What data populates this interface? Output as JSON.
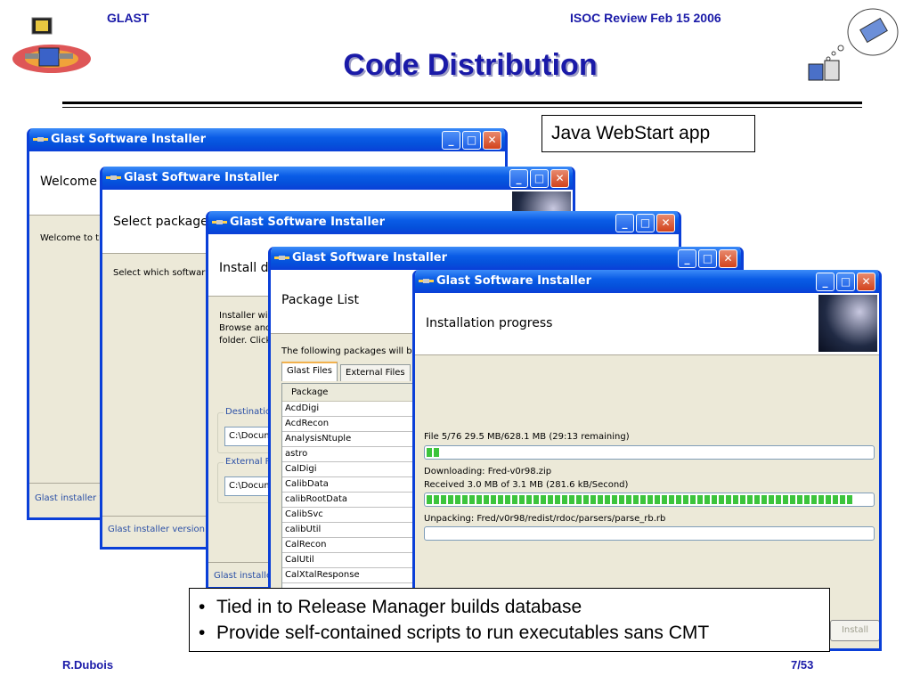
{
  "header": {
    "left": "GLAST",
    "right": "ISOC Review Feb 15 2006",
    "title": "Code Distribution"
  },
  "callout": "Java WebStart app",
  "window_title": "Glast Software Installer",
  "titlebar_buttons": {
    "minimize": "_",
    "maximize": "□",
    "close": "✕"
  },
  "win1": {
    "heading": "Welcome",
    "body": "Welcome to tl",
    "footer": "Glast installer v"
  },
  "win2": {
    "heading": "Select package",
    "body": "Select which softwar",
    "footer": "Glast installer version"
  },
  "win3": {
    "heading": "Install d",
    "body_lines": [
      "Installer wil",
      "Browse and",
      "folder. Click"
    ],
    "dest_legend": "Destinatic",
    "dest_value": "C:\\Docum",
    "ext_legend": "External F",
    "ext_value": "C:\\Docum",
    "footer": "Glast installe"
  },
  "win4": {
    "heading": "Package List",
    "intro": "The following packages will be",
    "tabs": [
      "Glast Files",
      "External Files"
    ],
    "column": "Package",
    "packages": [
      "AcdDigi",
      "AcdRecon",
      "AnalysisNtuple",
      "astro",
      "CalDigi",
      "CalibData",
      "calibRootData",
      "CalibSvc",
      "calibUtil",
      "CalRecon",
      "CalUtil",
      "CalXtalResponse"
    ]
  },
  "win5": {
    "heading": "Installation progress",
    "file_status": "File 5/76  29.5 MB/628.1 MB  (29:13 remaining)",
    "file_progress": 0.03,
    "downloading": "Downloading: Fred-v0r98.zip",
    "received": "Received 3.0 MB of 3.1 MB  (281.6 kB/Second)",
    "download_progress": 0.96,
    "unpacking": "Unpacking: Fred/v0r98/redist/rdoc/parsers/parse_rb.rb",
    "unpack_progress": 0,
    "install_button": "Install"
  },
  "bullets": [
    "Tied in to Release Manager builds database",
    "Provide self-contained scripts to run executables sans CMT"
  ],
  "bullet_char": "•",
  "footer": {
    "left": "R.Dubois",
    "right": "7/53"
  },
  "colors": {
    "title": "#1a1aa8",
    "xp_blue": "#0a5ce6",
    "progress": "#3cc43c"
  }
}
